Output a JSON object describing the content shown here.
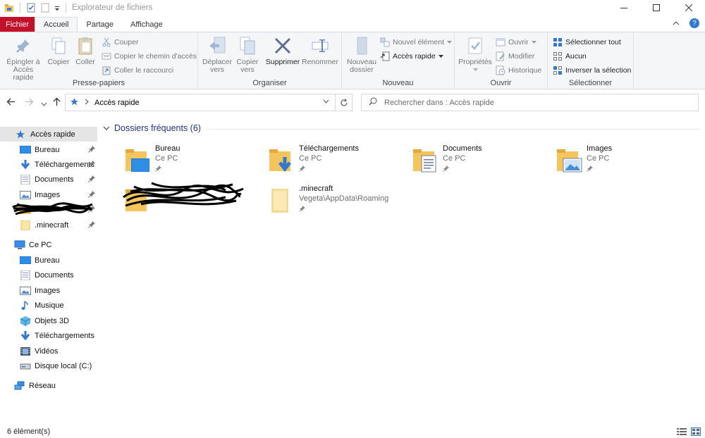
{
  "window": {
    "title": "Explorateur de fichiers"
  },
  "tabs": {
    "file": "Fichier",
    "home": "Accueil",
    "share": "Partage",
    "view": "Affichage"
  },
  "ribbon": {
    "clipboard": {
      "label": "Presse-papiers",
      "pin_line1": "Épingler à",
      "pin_line2": "Accès rapide",
      "copy": "Copier",
      "paste": "Coller",
      "cut": "Couper",
      "copy_path": "Copier le chemin d'accès",
      "paste_shortcut": "Coller le raccourci"
    },
    "organize": {
      "label": "Organiser",
      "move_line1": "Déplacer",
      "move_line2": "vers",
      "copy_line1": "Copier",
      "copy_line2": "vers",
      "delete": "Supprimer",
      "rename": "Renommer"
    },
    "new": {
      "label": "Nouveau",
      "folder_line1": "Nouveau",
      "folder_line2": "dossier",
      "new_item": "Nouvel élément",
      "easy_access": "Accès rapide"
    },
    "open": {
      "label": "Ouvrir",
      "properties": "Propriétés",
      "open": "Ouvrir",
      "edit": "Modifier",
      "history": "Historique"
    },
    "select": {
      "label": "Sélectionner",
      "select_all": "Sélectionner tout",
      "select_none": "Aucun",
      "invert": "Inverser la sélection"
    }
  },
  "address": {
    "path": "Accès rapide",
    "search_placeholder": "Rechercher dans : Accès rapide"
  },
  "nav": {
    "quick_access": "Accès rapide",
    "quick_items": [
      "Bureau",
      "Téléchargements",
      "Documents",
      "Images",
      ".minecraft"
    ],
    "this_pc": "Ce PC",
    "pc_items": [
      "Bureau",
      "Documents",
      "Images",
      "Musique",
      "Objets 3D",
      "Téléchargements",
      "Vidéos",
      "Disque local (C:)"
    ],
    "network": "Réseau"
  },
  "content": {
    "section_title": "Dossiers fréquents (6)",
    "folders": [
      {
        "name": "Bureau",
        "location": "Ce PC"
      },
      {
        "name": "Téléchargements",
        "location": "Ce PC"
      },
      {
        "name": "Documents",
        "location": "Ce PC"
      },
      {
        "name": "Images",
        "location": "Ce PC"
      },
      {
        "name": ".minecraft",
        "location": "Vegeta\\AppData\\Roaming"
      }
    ]
  },
  "status": {
    "count": "6 élément(s)"
  },
  "colors": {
    "file_tab": "#c40f2b",
    "folder": "#f4c55b",
    "accent_blue": "#1e3287",
    "nav_selected": "#e5e5e5"
  }
}
